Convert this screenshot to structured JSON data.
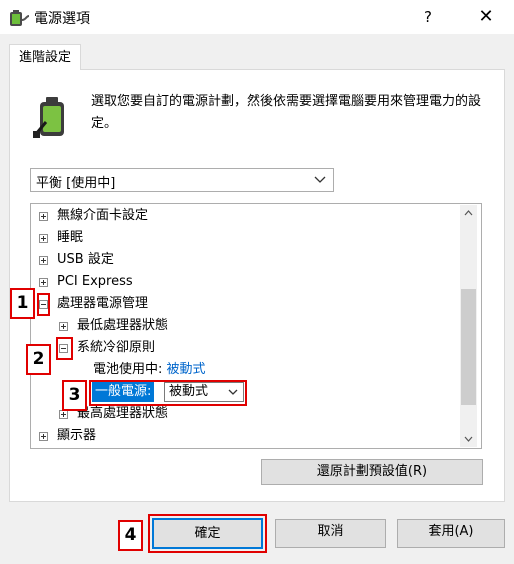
{
  "window": {
    "title": "電源選項",
    "help_glyph": "?",
    "close_glyph": "✕"
  },
  "tab": {
    "label": "進階設定"
  },
  "description": "選取您要自訂的電源計劃，然後依需要選擇電腦要用來管理電力的設定。",
  "plan_select": {
    "value": "平衡 [使用中]"
  },
  "tree": {
    "items": [
      {
        "label": "無線介面卡設定",
        "expander": "plus"
      },
      {
        "label": "睡眠",
        "expander": "plus"
      },
      {
        "label": "USB 設定",
        "expander": "plus"
      },
      {
        "label": "PCI Express",
        "expander": "plus"
      },
      {
        "label": "處理器電源管理",
        "expander": "minus"
      },
      {
        "label": "最低處理器狀態",
        "expander": "plus"
      },
      {
        "label": "系統冷卻原則",
        "expander": "minus"
      },
      {
        "label": "電池使用中:",
        "value": "被動式"
      },
      {
        "label": "最高處理器狀態",
        "expander": "plus"
      },
      {
        "label": "顯示器",
        "expander": "plus"
      }
    ],
    "inline_editor": {
      "label": "一般電源:",
      "selected": "被動式"
    }
  },
  "buttons": {
    "restore": "還原計劃預設值(R)",
    "ok": "確定",
    "cancel": "取消",
    "apply": "套用(A)"
  },
  "callouts": [
    "1",
    "2",
    "3",
    "4"
  ],
  "colors": {
    "accent": "#0078d7",
    "callout": "#e00000",
    "link": "#0066cc"
  },
  "icons": {
    "app": "power-battery-icon",
    "battery": "battery-plug-icon"
  }
}
